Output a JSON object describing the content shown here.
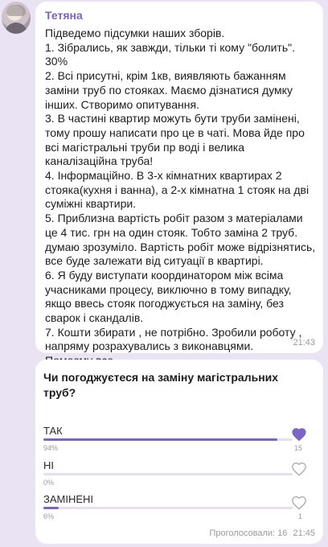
{
  "message": {
    "sender": "Тетяна",
    "text": "Підведемо підсумки наших зборів.\n1. Зібрались, як завжди, тільки ті кому \"болить\". 30%\n2. Всі присутні,  крім 1кв, виявляють бажанням заміни труб по стояках. Маємо дізнатися думку інших. Створимо опитування.\n3. В частині квартир можуть бути труби замінені, тому прошу написати про це в чаті. Мова йде про всі магістральні труби пр воді і велика каналізаційна труба!\n4. Інформаційно. В 3-х кімнатних квартирах 2 стояка(кухня і ванна), а 2-х кімнатна 1 стояк на дві суміжні квартири.\n5. Приблизна вартість робіт разом з матеріалами це 4 тис. грн на один стояк. Тобто заміна 2 труб. думаю зрозуміло. Вартість робіт може відрізнятись, все буде залежати від ситуації в квартирі.\n6. Я буду виступати координатором між всіма учасниками процесу, виключно в тому випадку, якщо ввесь стояк погоджується на заміну, без сварок і скандалів.\n7. Кошти збирати , не потрібно. Зробили роботу , напряму розрахувались з виконавцями.\nПомоєму все.",
    "time": "21:43"
  },
  "poll": {
    "question": "Чи погоджуєтеся на заміну магістральних труб?",
    "options": [
      {
        "label": "ТАК",
        "percent_text": "94%",
        "percent": 94,
        "count": "15",
        "liked": true
      },
      {
        "label": "НІ",
        "percent_text": "0%",
        "percent": 0,
        "count": "",
        "liked": false
      },
      {
        "label": "ЗАМІНЕНІ",
        "percent_text": "6%",
        "percent": 6,
        "count": "1",
        "liked": false
      }
    ],
    "votes_text": "Проголосовали: 16",
    "time": "21:45"
  },
  "colors": {
    "background": "#e9e3f3",
    "accent": "#7b63c7",
    "sender": "#7a62c6"
  },
  "icons": {
    "avatar": "user-photo",
    "vote": "heart-icon"
  }
}
